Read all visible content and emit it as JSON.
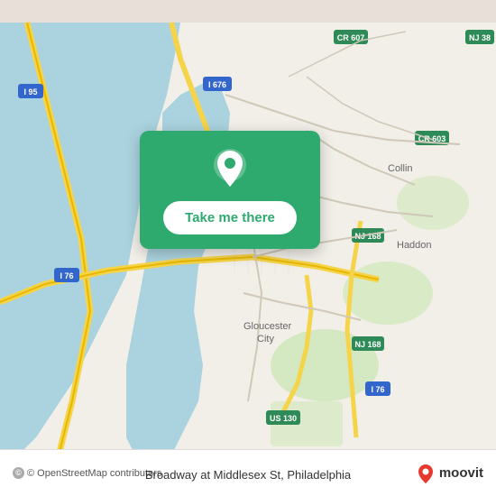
{
  "map": {
    "alt": "Map of Philadelphia area showing Broadway at Middlesex St"
  },
  "card": {
    "button_label": "Take me there"
  },
  "bottom_bar": {
    "attribution": "© OpenStreetMap contributors",
    "location": "Broadway at Middlesex St, Philadelphia",
    "moovit_label": "moovit"
  }
}
